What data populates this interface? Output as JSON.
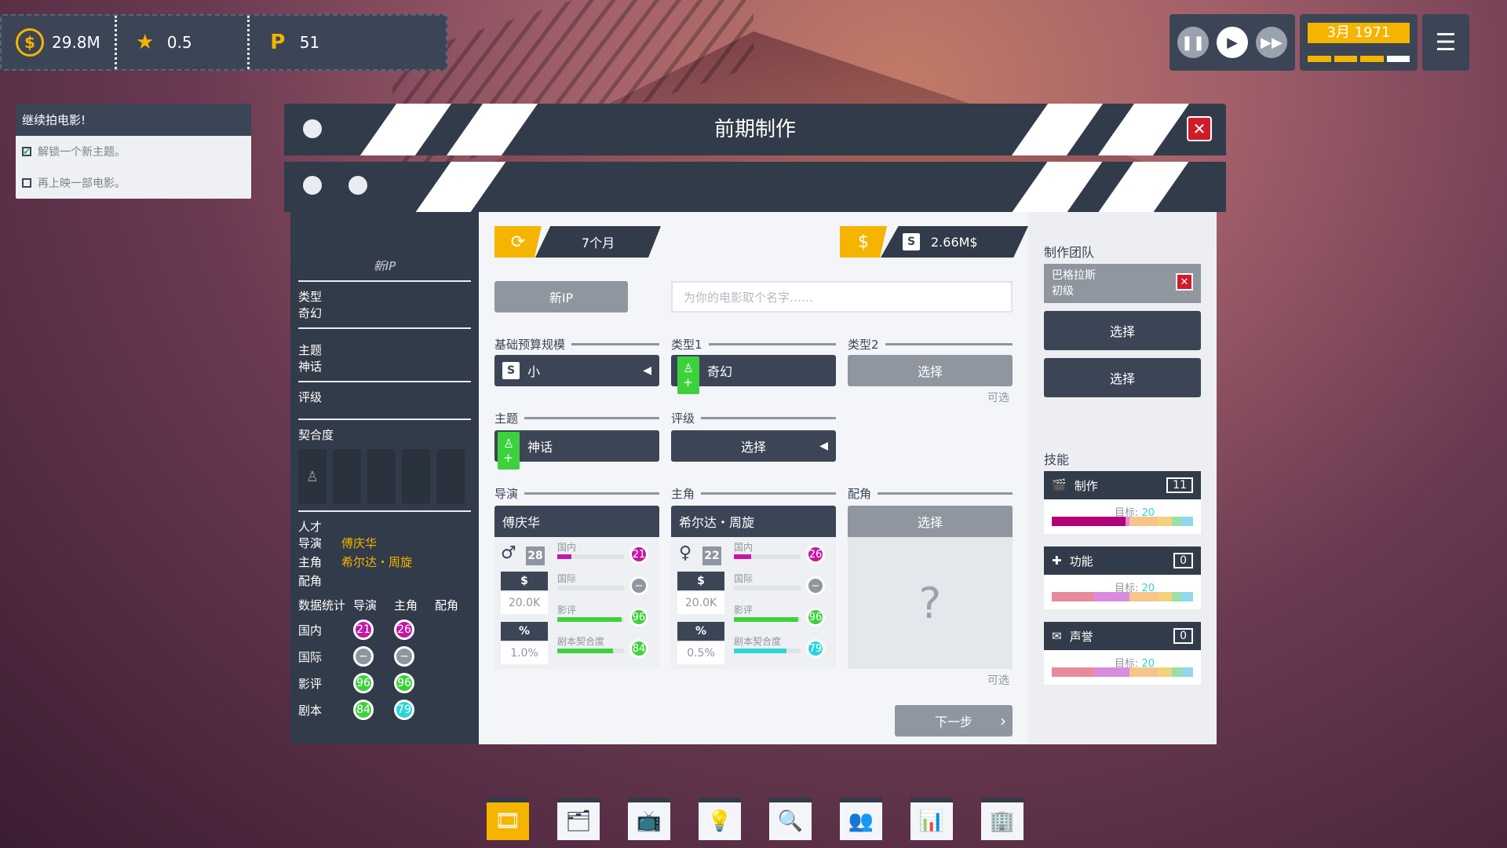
{
  "topbar": {
    "money": "29.8M",
    "rating": "0.5",
    "fans": "51"
  },
  "controls": {
    "date": "3月 1971"
  },
  "objectives": {
    "title": "继续拍电影!",
    "items": [
      "解锁一个新主题。",
      "再上映一部电影。"
    ]
  },
  "window": {
    "title": "前期制作"
  },
  "summary": {
    "ip_label": "新IP",
    "type_label": "类型",
    "type_value": "奇幻",
    "theme_label": "主题",
    "theme_value": "神话",
    "rating_label": "评级",
    "fit_label": "契合度",
    "talent_label": "人才",
    "director_label": "导演",
    "director_value": "傅庆华",
    "lead_label": "主角",
    "lead_value": "希尔达・周旋",
    "support_label": "配角",
    "stats_label": "数据统计",
    "col_director": "导演",
    "col_lead": "主角",
    "col_support": "配角",
    "rows": [
      {
        "label": "国内",
        "d": "21",
        "l": "26"
      },
      {
        "label": "国际",
        "d": "−",
        "l": "−"
      },
      {
        "label": "影评",
        "d": "96",
        "l": "96"
      },
      {
        "label": "剧本",
        "d": "84",
        "l": "79"
      }
    ]
  },
  "main": {
    "duration": "7个月",
    "cost_rank": "S",
    "cost": "2.66M$",
    "new_ip_button": "新IP",
    "name_placeholder": "为你的电影取个名字……",
    "budget_label": "基础预算规模",
    "budget_rank": "S",
    "budget_value": "小",
    "genre1_label": "类型1",
    "genre1_value": "奇幻",
    "genre2_label": "类型2",
    "genre2_button": "选择",
    "optional": "可选",
    "theme_label": "主题",
    "theme_value": "神话",
    "rating_label": "评级",
    "rating_button": "选择",
    "director_label": "导演",
    "lead_label": "主角",
    "support_label": "配角",
    "support_button": "选择",
    "support_q": "?",
    "next_button": "下一步",
    "cards": [
      {
        "name": "傅庆华",
        "age": "28",
        "pay": "20.0K",
        "share": "1.0%",
        "dom_label": "国内",
        "intl_label": "国际",
        "critic_label": "影评",
        "script_label": "剧本契合度",
        "dom": "21",
        "intl": "−",
        "critic": "96",
        "script": "84",
        "dom_pct": 0.21,
        "critic_pct": 0.96,
        "script_pct": 0.84,
        "script_color": "#3ed13e"
      },
      {
        "name": "希尔达・周旋",
        "age": "22",
        "pay": "20.0K",
        "share": "0.5%",
        "dom_label": "国内",
        "intl_label": "国际",
        "critic_label": "影评",
        "script_label": "剧本契合度",
        "dom": "26",
        "intl": "−",
        "critic": "96",
        "script": "79",
        "dom_pct": 0.26,
        "critic_pct": 0.96,
        "script_pct": 0.79,
        "script_color": "#2cd4d9"
      }
    ],
    "money_sym": "$",
    "pct_sym": "%"
  },
  "right": {
    "team_title": "制作团队",
    "team_member": "巴格拉斯",
    "team_level": "初级",
    "select1": "选择",
    "select2": "选择",
    "skills_title": "技能",
    "skills": [
      {
        "name": "制作",
        "value": "11",
        "target_label": "目标: ",
        "target": "20",
        "level": 0.52
      },
      {
        "name": "功能",
        "value": "0",
        "target_label": "目标: ",
        "target": "20",
        "level": 0.0
      },
      {
        "name": "声誉",
        "value": "0",
        "target_label": "目标: ",
        "target": "20",
        "level": 0.0
      }
    ]
  },
  "dock": [
    "film-icon",
    "folder-icon",
    "tv-icon",
    "idea-icon",
    "search-icon",
    "people-icon",
    "chart-icon",
    "building-icon"
  ],
  "colors": {
    "accent": "#f5b400",
    "panel": "#323b49",
    "close": "#d01c2a",
    "green": "#3ed13e",
    "magenta": "#c318a6",
    "cyan": "#2cd4d9"
  }
}
